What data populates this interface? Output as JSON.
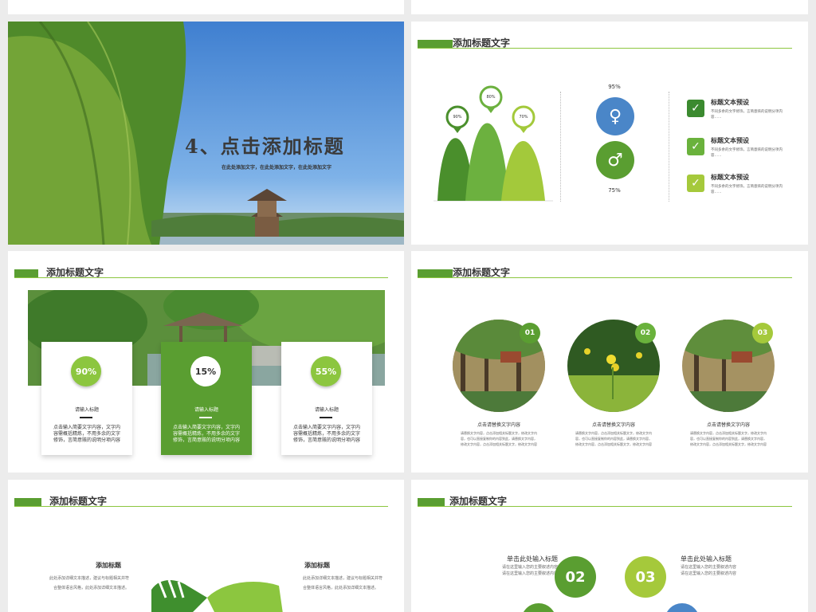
{
  "slide1": {
    "title": "4、点击添加标题",
    "subtitle": "在此处添加文字，在此处添加文字，在此处添加文字"
  },
  "slide2": {
    "header": "添加标题文字",
    "mountains": [
      {
        "pct": "90%"
      },
      {
        "pct": "80%"
      },
      {
        "pct": "70%"
      }
    ],
    "female_pct": "95%",
    "male_pct": "75%",
    "items": [
      {
        "title": "标题文本预设",
        "text": "不同多余的文字修饰，言简意赅的说明分项内容……",
        "color": "#3b8a2f"
      },
      {
        "title": "标题文本预设",
        "text": "不同多余的文字修饰，言简意赅的说明分项内容……",
        "color": "#6ab23c"
      },
      {
        "title": "标题文本预设",
        "text": "不同多余的文字修饰，言简意赅的说明分项内容……",
        "color": "#a5c93b"
      }
    ]
  },
  "slide3": {
    "header": "添加标题文字",
    "cards": [
      {
        "pct": "90%",
        "label": "请输入标题",
        "text": "点击输入简要文字内容，文字内容需概括精炼，不用多余的文字修饰，言简意赅的说明分项内容"
      },
      {
        "pct": "15%",
        "label": "请输入标题",
        "text": "点击输入简要文字内容，文字内容需概括精炼，不用多余的文字修饰，言简意赅的说明分项内容"
      },
      {
        "pct": "55%",
        "label": "请输入标题",
        "text": "点击输入简要文字内容，文字内容需概括精炼，不用多余的文字修饰，言简意赅的说明分项内容"
      }
    ]
  },
  "slide4": {
    "header": "添加标题文字",
    "circles": [
      {
        "num": "01",
        "caption": "点击请替换文字内容",
        "text": "请替换文字内容，点击添加相关标题文字，修改文字内容，也可以直接复制你的内容到此，请替换文字内容，修改文字内容，点击添加相关标题文字，修改文字内容"
      },
      {
        "num": "02",
        "caption": "点击请替换文字内容",
        "text": "请替换文字内容，点击添加相关标题文字，修改文字内容，也可以直接复制你的内容到此，请替换文字内容，修改文字内容，点击添加相关标题文字，修改文字内容"
      },
      {
        "num": "03",
        "caption": "点击请替换文字内容",
        "text": "请替换文字内容，点击添加相关标题文字，修改文字内容，也可以直接复制你的内容到此，请替换文字内容，修改文字内容，点击添加相关标题文字，修改文字内容"
      }
    ]
  },
  "slide5": {
    "header": "添加标题文字",
    "left_title": "添加标题",
    "left_text": "此处添加详细文本描述，建议与标题相关并符合整体语言风格，此处添加详细文本描述。",
    "right_title": "添加标题",
    "right_text": "此处添加详细文本描述，建议与标题相关并符合整体语言风格，此处添加详细文本描述。"
  },
  "slide6": {
    "header": "添加标题文字",
    "left_title": "单击此处输入标题",
    "left_text": "请在这里输入您的主要叙述内容\n请在这里输入您的主要叙述内容",
    "right_title": "单击此处输入标题",
    "right_text": "请在这里输入您的主要叙述内容\n请在这里输入您的主要叙述内容",
    "num_a": "02",
    "num_b": "03"
  },
  "colors": {
    "green": "#5a9e31",
    "light_green": "#8cc63f",
    "blue": "#4a86c8"
  }
}
